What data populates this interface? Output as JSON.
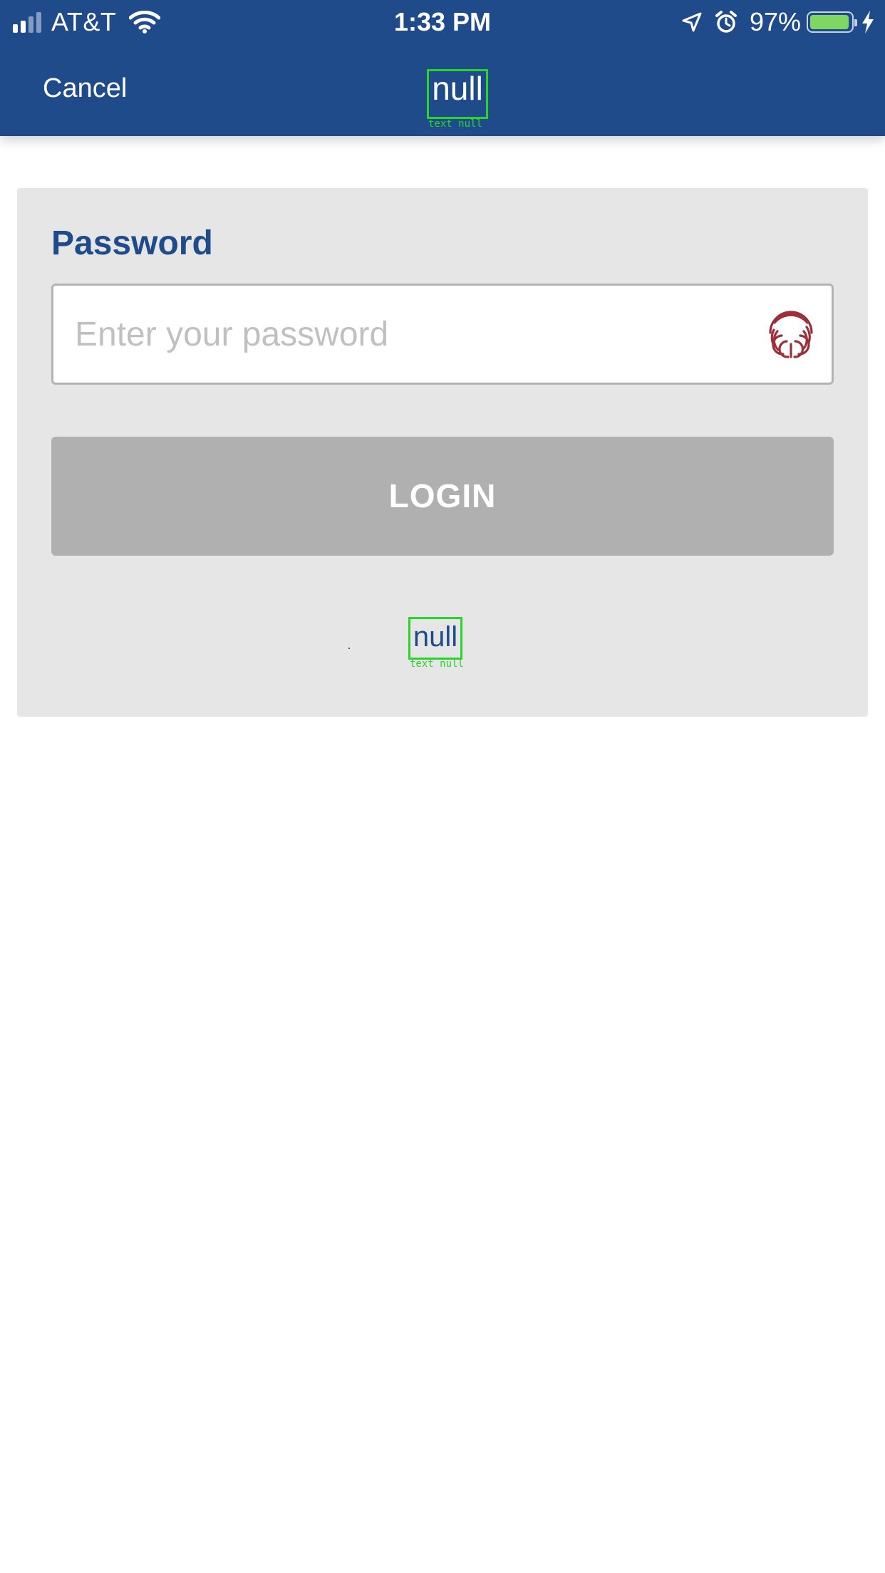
{
  "status_bar": {
    "carrier": "AT&T",
    "time": "1:33 PM",
    "battery_percent": "97%",
    "battery_level": 0.97,
    "icons": [
      "signal-icon",
      "wifi-icon",
      "location-arrow-icon",
      "alarm-icon",
      "battery-icon",
      "charging-bolt-icon"
    ]
  },
  "nav": {
    "cancel_label": "Cancel",
    "title": "null",
    "title_debug_tag": "text null"
  },
  "form": {
    "password_label": "Password",
    "password_placeholder": "Enter your password",
    "password_value": "",
    "fingerprint_icon": "fingerprint-icon",
    "login_label": "LOGIN",
    "footer_link_label": "null",
    "footer_debug_tag": "text null"
  },
  "colors": {
    "brand_blue": "#1f4b8a",
    "card_bg": "#e6e6e6",
    "button_disabled": "#b0b0b0",
    "fingerprint_red": "#9c2f3a",
    "debug_green": "#2bd42b",
    "battery_green": "#7ed663"
  }
}
